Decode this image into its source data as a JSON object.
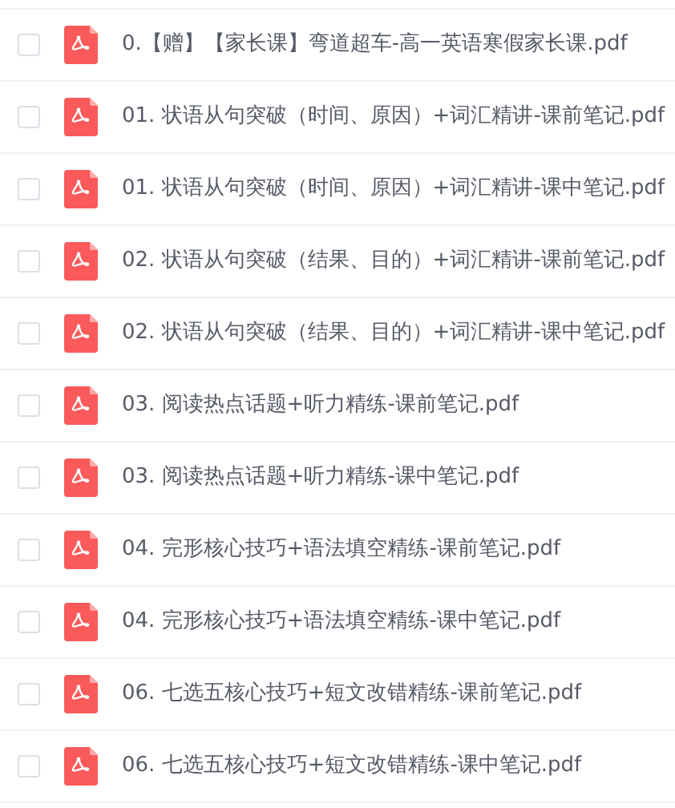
{
  "files": [
    {
      "name": "0.【赠】【家长课】弯道超车-高一英语寒假家长课.pdf",
      "checked": false
    },
    {
      "name": "01. 状语从句突破（时间、原因）+词汇精讲-课前笔记.pdf",
      "checked": false
    },
    {
      "name": "01. 状语从句突破（时间、原因）+词汇精讲-课中笔记.pdf",
      "checked": false
    },
    {
      "name": "02. 状语从句突破（结果、目的）+词汇精讲-课前笔记.pdf",
      "checked": false
    },
    {
      "name": "02. 状语从句突破（结果、目的）+词汇精讲-课中笔记.pdf",
      "checked": false
    },
    {
      "name": "03. 阅读热点话题+听力精练-课前笔记.pdf",
      "checked": false
    },
    {
      "name": "03. 阅读热点话题+听力精练-课中笔记.pdf",
      "checked": false
    },
    {
      "name": "04. 完形核心技巧+语法填空精练-课前笔记.pdf",
      "checked": false
    },
    {
      "name": "04. 完形核心技巧+语法填空精练-课中笔记.pdf",
      "checked": false
    },
    {
      "name": "06. 七选五核心技巧+短文改错精练-课前笔记.pdf",
      "checked": false
    },
    {
      "name": "06. 七选五核心技巧+短文改错精练-课中笔记.pdf",
      "checked": false
    }
  ]
}
